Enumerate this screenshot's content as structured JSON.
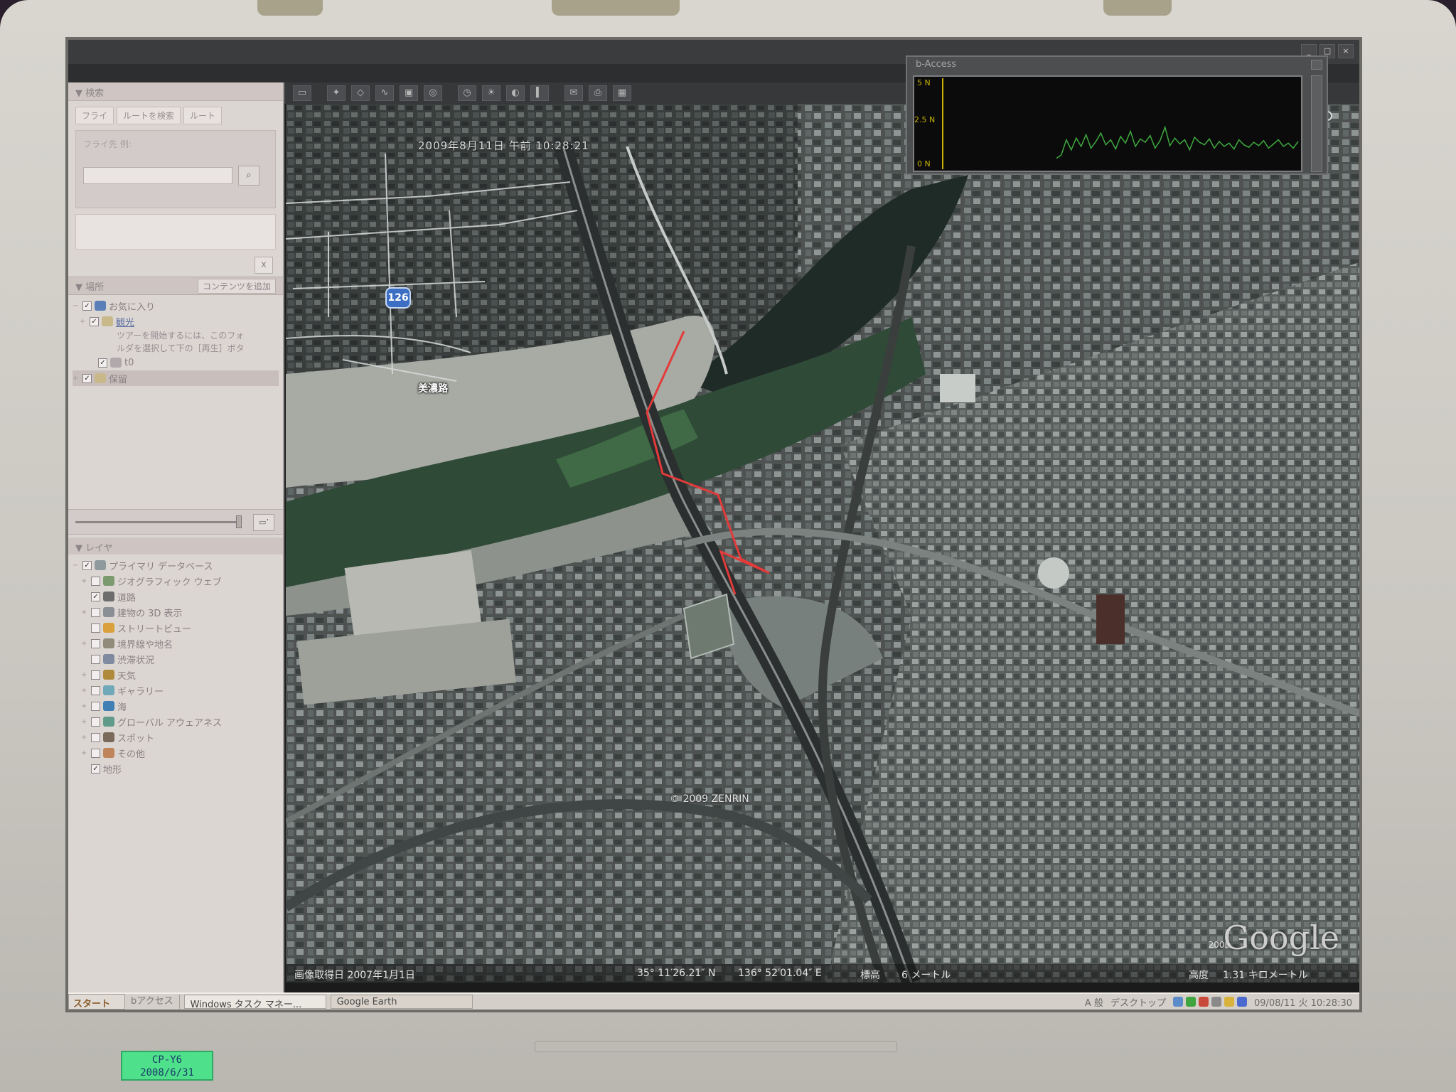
{
  "device": {
    "sticker_line1": "CP-Y6",
    "sticker_line2": "2008/6/31"
  },
  "window": {
    "title": "",
    "menu": [
      "",
      "",
      "",
      "",
      "",
      ""
    ]
  },
  "sidebar": {
    "search_header": "検索",
    "search_tabs": [
      "フライ",
      "ルートを検索",
      "ルート"
    ],
    "search_label": "フライ先 例:",
    "search_value": "",
    "close_label": "x",
    "places_header": "場所",
    "add_content": "コンテンツを追加",
    "places": [
      {
        "label": "お気に入り",
        "checked": true,
        "expand": "−"
      },
      {
        "label": "観光",
        "checked": true,
        "expand": "+",
        "link": true
      },
      {
        "label": "t0",
        "checked": true,
        "expand": ""
      },
      {
        "label": "保留",
        "checked": true,
        "expand": "+"
      }
    ],
    "tour_note_1": "ツアーを開始するには、このフォ",
    "tour_note_2": "ルダを選択して下の［再生］ボタ",
    "layers_header": "レイヤ",
    "layers": [
      {
        "label": "プライマリ データベース",
        "checked": true,
        "expand": "−",
        "color": "#8e9a9e"
      },
      {
        "label": "ジオグラフィック ウェブ",
        "checked": false,
        "expand": "+",
        "color": "#7b9a6e"
      },
      {
        "label": "道路",
        "checked": true,
        "expand": "",
        "color": "#6d6d6d"
      },
      {
        "label": "建物の 3D 表示",
        "checked": false,
        "expand": "+",
        "color": "#8a8f96"
      },
      {
        "label": "ストリートビュー",
        "checked": false,
        "expand": "",
        "color": "#d9a03c"
      },
      {
        "label": "境界線や地名",
        "checked": false,
        "expand": "+",
        "color": "#8f8a7a"
      },
      {
        "label": "渋滞状況",
        "checked": false,
        "expand": "",
        "color": "#7f8aa0"
      },
      {
        "label": "天気",
        "checked": false,
        "expand": "+",
        "color": "#b08a3c"
      },
      {
        "label": "ギャラリー",
        "checked": false,
        "expand": "+",
        "color": "#6fa8b8"
      },
      {
        "label": "海",
        "checked": false,
        "expand": "+",
        "color": "#3f7fb4"
      },
      {
        "label": "グローバル アウェアネス",
        "checked": false,
        "expand": "+",
        "color": "#5f9a8a"
      },
      {
        "label": "スポット",
        "checked": false,
        "expand": "+",
        "color": "#7a6a5a"
      },
      {
        "label": "その他",
        "checked": false,
        "expand": "+",
        "color": "#c0845a"
      },
      {
        "label": "地形",
        "checked": true,
        "expand": "",
        "color": ""
      }
    ]
  },
  "toolbar": {
    "icons": [
      "sidebar-icon",
      "placemark-icon",
      "polygon-icon",
      "path-icon",
      "overlay-icon",
      "tour-icon",
      "historical-imagery-icon",
      "sunlight-icon",
      "planet-icon",
      "ruler-icon",
      "email-icon",
      "print-icon",
      "view-maps-icon"
    ],
    "glyphs": [
      "▭",
      "✦",
      "◇",
      "∿",
      "▣",
      "◎",
      "◷",
      "☀",
      "◐",
      "▍",
      "✉",
      "⎙",
      "▦"
    ]
  },
  "map": {
    "timestamp": "2009年8月11日 午前 10:28:21",
    "route_badge": "126",
    "road_label": "美濃路",
    "copyright": "© 2009 ZENRIN",
    "google": "Google",
    "google_year": "2009",
    "imagery_date": "画像取得日 2007年1月1日",
    "lat": "35° 11′26.21″ N",
    "lon": "136° 52′01.04″ E",
    "elev_label": "標高",
    "elev_value": "6 メートル",
    "alt_label": "高度",
    "alt_value": "1.31 キロメートル",
    "overlay_path_color": "#e33a3a"
  },
  "baccess": {
    "title": "b-Access",
    "y_labels": [
      "5 N",
      "2.5 N",
      "0 N"
    ],
    "line_color": "#3fa93f",
    "series": [
      0.08,
      0.12,
      0.3,
      0.18,
      0.32,
      0.22,
      0.36,
      0.2,
      0.28,
      0.38,
      0.24,
      0.3,
      0.19,
      0.34,
      0.26,
      0.4,
      0.22,
      0.31,
      0.27,
      0.35,
      0.2,
      0.29,
      0.45,
      0.23,
      0.32,
      0.25,
      0.3,
      0.18,
      0.33,
      0.27,
      0.24,
      0.31,
      0.2,
      0.28,
      0.22,
      0.26,
      0.19,
      0.3,
      0.24,
      0.21,
      0.27,
      0.23,
      0.29,
      0.2,
      0.25,
      0.3,
      0.22,
      0.26,
      0.2,
      0.28
    ]
  },
  "taskbar": {
    "start": "スタート",
    "quicklaunch": "bアクセス",
    "tasks": [
      "Windows タスク マネー...",
      "Google Earth"
    ],
    "ime_label": "A 般",
    "desktop_label": "デスクトップ",
    "clock": "09/08/11 火 10:28:30"
  }
}
